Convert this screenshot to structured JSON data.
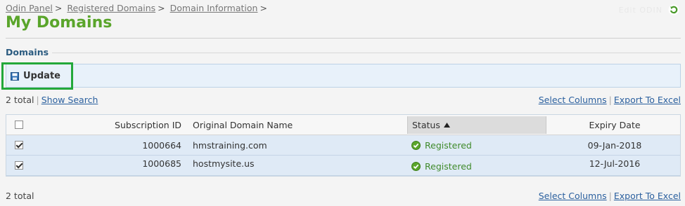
{
  "breadcrumb": {
    "items": [
      "Odin Panel",
      "Registered Domains",
      "Domain Information"
    ],
    "separator": ">"
  },
  "header": {
    "faded_text": "Edit   ODIN",
    "refresh_icon": "refresh-icon"
  },
  "page": {
    "title": "My Domains",
    "section_label": "Domains"
  },
  "toolbar": {
    "update_label": "Update",
    "update_icon": "save-icon"
  },
  "summary_top": {
    "total": "2 total",
    "show_search": "Show Search",
    "select_columns": "Select Columns",
    "export": "Export To Excel"
  },
  "summary_bottom": {
    "total": "2 total",
    "select_columns": "Select Columns",
    "export": "Export To Excel"
  },
  "table": {
    "columns": [
      "Subscription ID",
      "Original Domain Name",
      "Status",
      "Expiry Date"
    ],
    "sort_indicator": "ascending",
    "rows": [
      {
        "checked": true,
        "subscription_id": "1000664",
        "domain": "hmstraining.com",
        "status": "Registered",
        "expiry": "09-Jan-2018"
      },
      {
        "checked": true,
        "subscription_id": "1000685",
        "domain": "hostmysite.us",
        "status": "Registered",
        "expiry": "12-Jul-2016"
      }
    ]
  },
  "colors": {
    "title_green": "#5aa52b",
    "highlight_green": "#23a83a",
    "link_blue": "#2a5f9e",
    "row_blue": "#dfeaf6"
  }
}
